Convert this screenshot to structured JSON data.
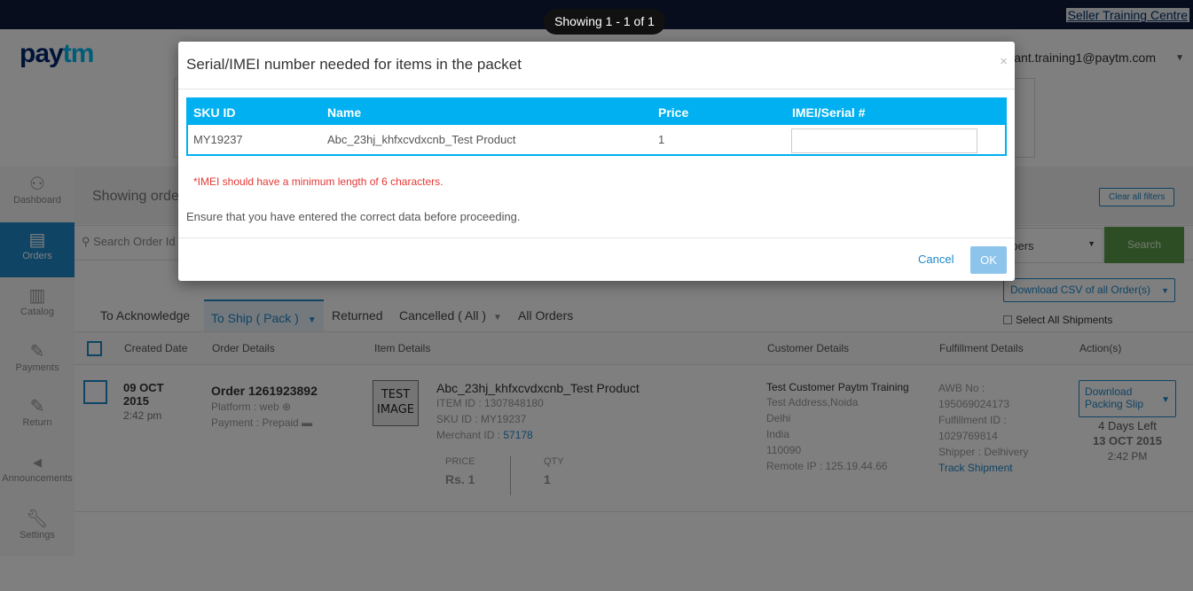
{
  "header": {
    "training_link": "Seller Training Centre",
    "logo_pay": "pay",
    "logo_tm": "tm",
    "user_email": "ant.training1@paytm.com"
  },
  "toast": {
    "text": "Showing 1 - 1 of 1"
  },
  "sidebar": {
    "items": [
      {
        "label": "Dashboard",
        "icon": "dashboard-icon",
        "active": false
      },
      {
        "label": "Orders",
        "icon": "orders-icon",
        "active": true
      },
      {
        "label": "Catalog",
        "icon": "catalog-icon",
        "active": false
      },
      {
        "label": "Payments",
        "icon": "payments-icon",
        "active": false
      },
      {
        "label": "Return",
        "icon": "return-icon",
        "active": false
      },
      {
        "label": "Announcements",
        "icon": "megaphone-icon",
        "active": false
      },
      {
        "label": "Settings",
        "icon": "wrench-icon",
        "active": false
      }
    ]
  },
  "filters": {
    "showing_orders": "Showing orde",
    "clear_all": "Clear all filters",
    "search_placeholder": "Search Order Id",
    "shipper_select": "ppers",
    "search_button": "Search",
    "csv_button": "Download CSV of all Order(s)",
    "select_all": "Select All Shipments"
  },
  "tabs": [
    {
      "label": "To Acknowledge"
    },
    {
      "label": "To Ship ( Pack )"
    },
    {
      "label": "Returned"
    },
    {
      "label": "Cancelled ( All )"
    },
    {
      "label": "All Orders"
    }
  ],
  "table": {
    "headers": [
      "Created Date",
      "Order Details",
      "Item Details",
      "Customer Details",
      "Fulfillment Details",
      "Action(s)"
    ],
    "row": {
      "date": "09 OCT 2015",
      "time": "2:42 pm",
      "order": "Order 1261923892",
      "platform": "Platform : web",
      "payment": "Payment : Prepaid",
      "image_text": "TEST IMAGE",
      "product_name": "Abc_23hj_khfxcvdxcnb_Test Product",
      "item_id": "ITEM ID : 1307848180",
      "sku_id": "SKU ID : MY19237",
      "merchant_label": "Merchant ID : ",
      "merchant_id": "57178",
      "price_label": "PRICE",
      "price_value": "Rs. 1",
      "qty_label": "QTY",
      "qty_value": "1",
      "customer_name": "Test Customer Paytm Training",
      "customer_address": "Test Address,Noida",
      "customer_city": "Delhi",
      "customer_country": "India",
      "customer_pin": "110090",
      "remote_ip": "Remote IP : 125.19.44.66",
      "awb_label": "AWB No :",
      "awb_value": "195069024173",
      "fulfillment_label": "Fulfillment ID :",
      "fulfillment_value": "1029769814",
      "shipper": "Shipper : Delhivery",
      "track": "Track Shipment",
      "pack_button": "Download Packing Slip",
      "days_left": "4 Days Left",
      "due_date": "13 OCT 2015",
      "due_time": "2:42 PM"
    }
  },
  "modal": {
    "title": "Serial/IMEI number needed for items in the packet",
    "close": "×",
    "table_headers": [
      "SKU ID",
      "Name",
      "Price",
      "IMEI/Serial #"
    ],
    "row": {
      "sku": "MY19237",
      "name": "Abc_23hj_khfxcvdxcnb_Test Product",
      "price": "1",
      "imei_value": ""
    },
    "error": "*IMEI should have a minimum length of 6 characters.",
    "ensure": "Ensure that you have entered the correct data before proceeding.",
    "cancel": "Cancel",
    "ok": "OK"
  },
  "colors": {
    "accent": "#1e88c9",
    "modal_header": "#00b0f0",
    "error": "#e53935",
    "search_button": "#5b9a4a",
    "topbar": "#0f1a3a"
  }
}
